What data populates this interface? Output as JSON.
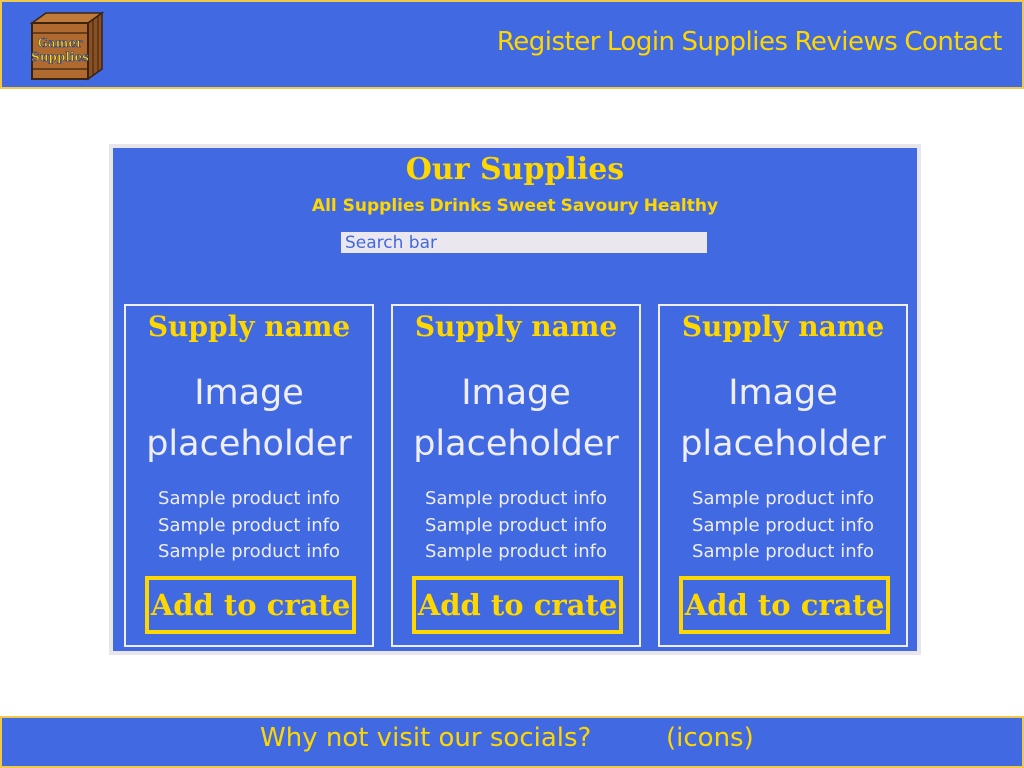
{
  "header": {
    "logo_text": [
      "Gamer",
      "Supplies"
    ],
    "nav": [
      "Register",
      "Login",
      "Supplies",
      "Reviews",
      "Contact"
    ]
  },
  "main": {
    "title": "Our Supplies",
    "filters": [
      "All Supplies",
      "Drinks",
      "Sweet",
      "Savoury",
      "Healthy"
    ],
    "search_placeholder": "Search bar",
    "products": [
      {
        "name": "Supply name",
        "image_lines": [
          "Image",
          "placeholder"
        ],
        "info": [
          "Sample product info",
          "Sample product info",
          "Sample product info"
        ],
        "button": "Add to crate"
      },
      {
        "name": "Supply name",
        "image_lines": [
          "Image",
          "placeholder"
        ],
        "info": [
          "Sample product info",
          "Sample product info",
          "Sample product info"
        ],
        "button": "Add to crate"
      },
      {
        "name": "Supply name",
        "image_lines": [
          "Image",
          "placeholder"
        ],
        "info": [
          "Sample product info",
          "Sample product info",
          "Sample product info"
        ],
        "button": "Add to crate"
      }
    ]
  },
  "footer": {
    "text": "Why not visit our socials?",
    "icons_label": "(icons)"
  },
  "colors": {
    "primary": "#4169e1",
    "accent": "#ffd700",
    "border": "#f2c84b",
    "light": "#efeef6",
    "search_bg": "#ebe7ee"
  }
}
